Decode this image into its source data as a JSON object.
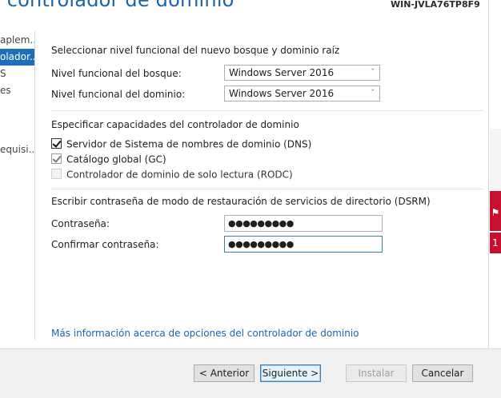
{
  "header": {
    "title": "l controlador de dominio",
    "server_name": "WIN-JVLA76TP8F9"
  },
  "nav": {
    "items": [
      {
        "label": "aplem..."
      },
      {
        "label": "olador...",
        "active": true
      },
      {
        "label": "S"
      },
      {
        "label": "es"
      },
      {
        "label": ""
      },
      {
        "label": ""
      },
      {
        "label": ""
      },
      {
        "label": "equisi..."
      }
    ]
  },
  "form": {
    "functional_level_heading": "Seleccionar nivel funcional del nuevo bosque y dominio raíz",
    "forest_level_label": "Nivel funcional del bosque:",
    "forest_level_value": "Windows Server 2016",
    "domain_level_label": "Nivel funcional del dominio:",
    "domain_level_value": "Windows Server 2016",
    "capabilities_heading": "Especificar capacidades del controlador de dominio",
    "dns_label": "Servidor de Sistema de nombres de dominio (DNS)",
    "gc_label": "Catálogo global (GC)",
    "rodc_label": "Controlador de dominio de solo lectura (RODC)",
    "dsrm_heading": "Escribir contraseña de modo de restauración de servicios de directorio (DSRM)",
    "password_label": "Contraseña:",
    "password_value": "●●●●●●●●●",
    "confirm_label": "Confirmar contraseña:",
    "confirm_value": "●●●●●●●●●"
  },
  "checkboxes": {
    "dns": true,
    "gc": true,
    "rodc": false
  },
  "link": {
    "more_info": "Más información acerca de opciones del controlador de dominio"
  },
  "footer": {
    "back_label": "< Anterior",
    "next_label": "Siguiente >",
    "install_label": "Instalar",
    "cancel_label": "Cancelar"
  },
  "side_badge": {
    "count": "1"
  },
  "colors": {
    "accent": "#1a64ad",
    "nav_active": "#1e6fb9",
    "alert_red": "#c8102e"
  }
}
